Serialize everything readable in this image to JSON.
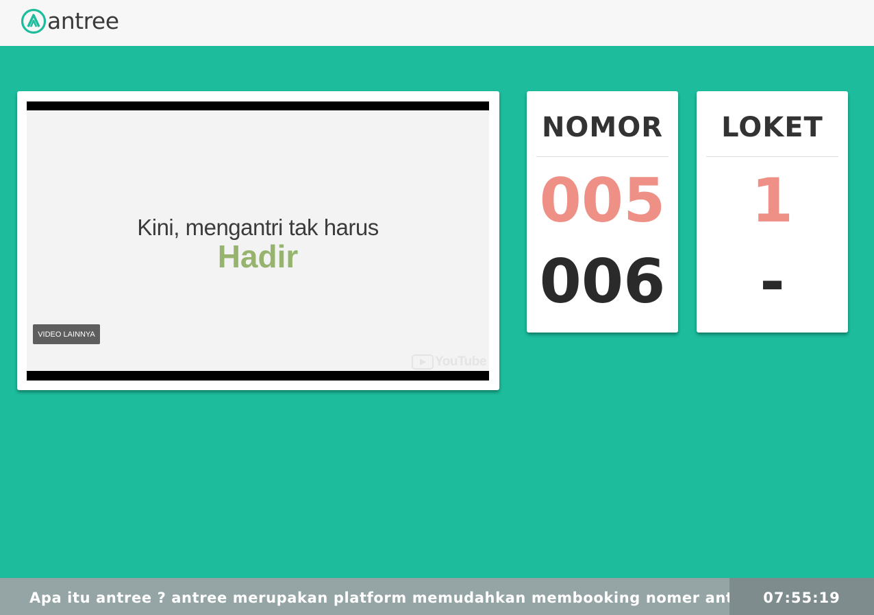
{
  "header": {
    "logo_text": "antree",
    "brand_color": "#1cbc9c"
  },
  "video": {
    "headline": "Kini, mengantri tak harus",
    "highlight": "Hadir",
    "more_button": "VIDEO LAINNYA",
    "provider_label": "YouTube"
  },
  "nomor_card": {
    "title": "NOMOR",
    "current": "005",
    "next": "006"
  },
  "loket_card": {
    "title": "LOKET",
    "current": "1",
    "next": "-"
  },
  "footer": {
    "ticker": "Apa itu antree ? antree merupakan platform memudahkan membooking nomer antrian",
    "clock": "07:55:19"
  },
  "colors": {
    "background": "#1cbc9c",
    "current_number": "#ef9086",
    "next_number": "#2a2a2a",
    "footer": "#95a5a6",
    "clock_bg": "#7f8c8d"
  }
}
